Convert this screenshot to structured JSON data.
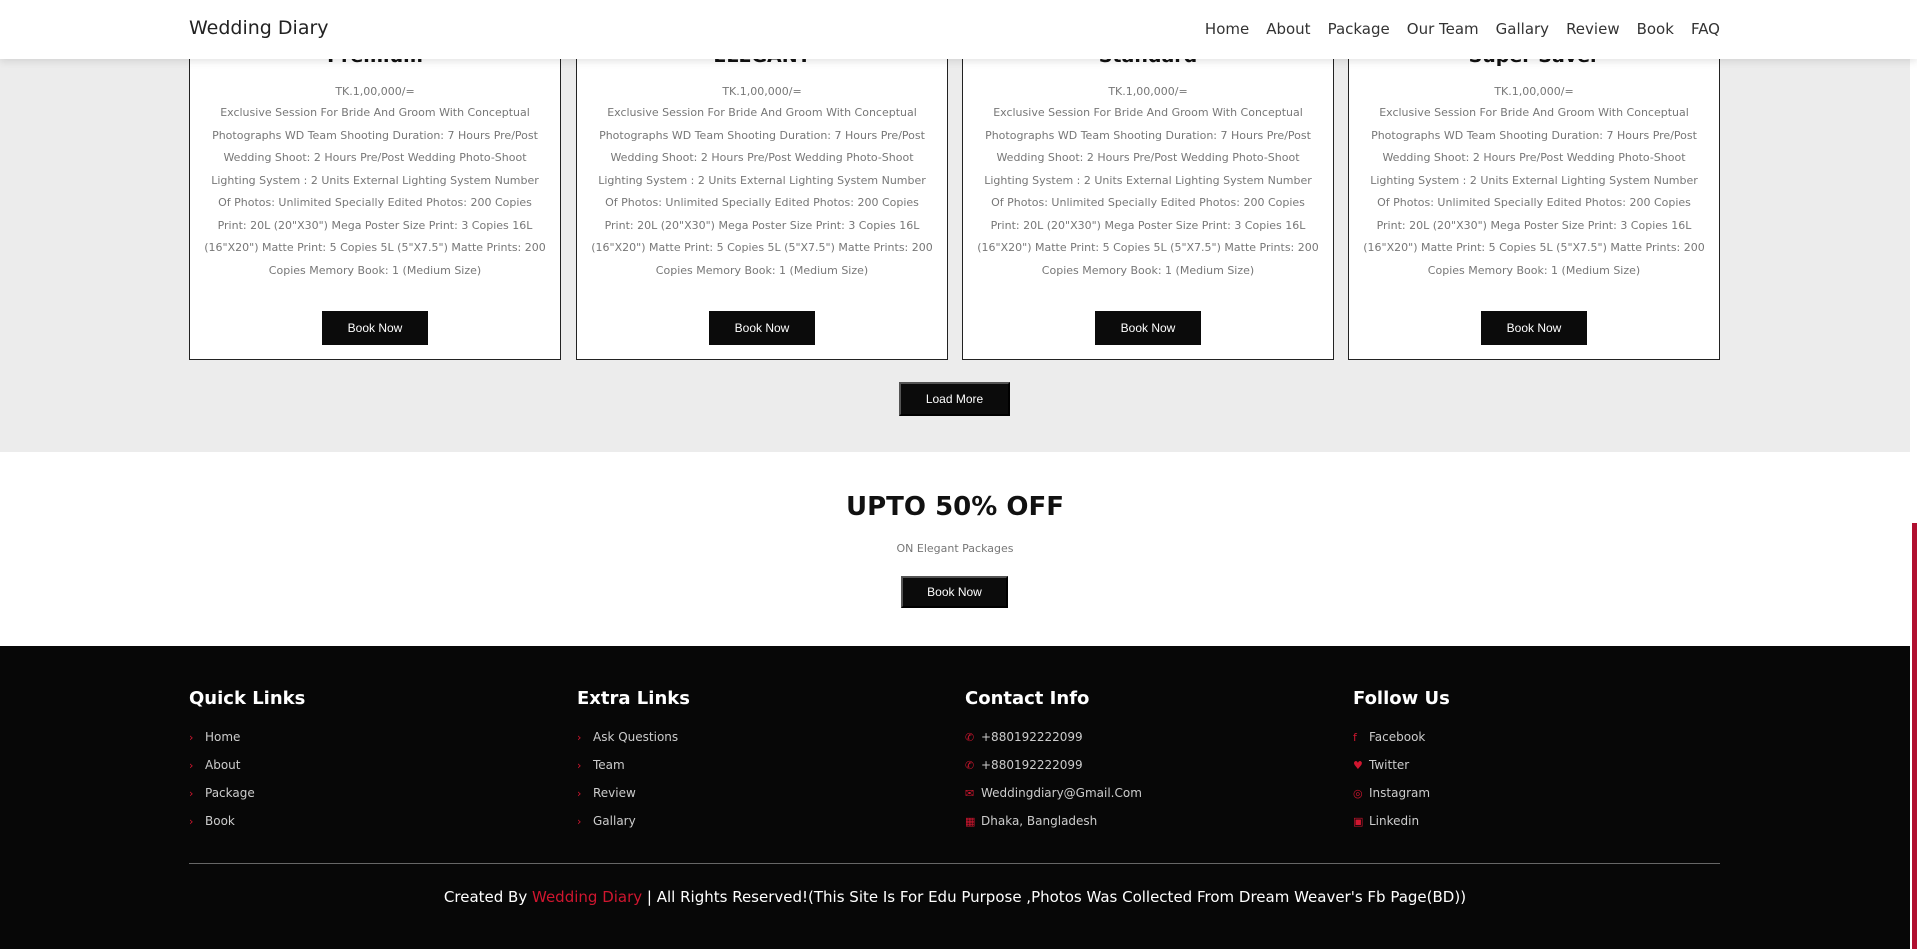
{
  "header": {
    "brand": "Wedding Diary",
    "nav": [
      "Home",
      "About",
      "Package",
      "Our Team",
      "Gallary",
      "Review",
      "Book",
      "FAQ"
    ]
  },
  "packages": [
    {
      "title": "Premium",
      "price": "TK.1,00,000/=",
      "description": "Exclusive Session For Bride And Groom With Conceptual Photographs WD Team Shooting Duration: 7 Hours Pre/Post Wedding Shoot: 2 Hours Pre/Post Wedding Photo-Shoot Lighting System : 2 Units External Lighting System Number Of Photos: Unlimited Specially Edited Photos: 200 Copies Print: 20L (20\"X30\") Mega Poster Size Print: 3 Copies 16L (16\"X20\") Matte Print: 5 Copies 5L (5\"X7.5\") Matte Prints: 200 Copies Memory Book: 1 (Medium Size)",
      "button": "Book Now"
    },
    {
      "title": "ELEGANT",
      "price": "TK.1,00,000/=",
      "description": "Exclusive Session For Bride And Groom With Conceptual Photographs WD Team Shooting Duration: 7 Hours Pre/Post Wedding Shoot: 2 Hours Pre/Post Wedding Photo-Shoot Lighting System : 2 Units External Lighting System Number Of Photos: Unlimited Specially Edited Photos: 200 Copies Print: 20L (20\"X30\") Mega Poster Size Print: 3 Copies 16L (16\"X20\") Matte Print: 5 Copies 5L (5\"X7.5\") Matte Prints: 200 Copies Memory Book: 1 (Medium Size)",
      "button": "Book Now"
    },
    {
      "title": "Standard",
      "price": "TK.1,00,000/=",
      "description": "Exclusive Session For Bride And Groom With Conceptual Photographs WD Team Shooting Duration: 7 Hours Pre/Post Wedding Shoot: 2 Hours Pre/Post Wedding Photo-Shoot Lighting System : 2 Units External Lighting System Number Of Photos: Unlimited Specially Edited Photos: 200 Copies Print: 20L (20\"X30\") Mega Poster Size Print: 3 Copies 16L (16\"X20\") Matte Print: 5 Copies 5L (5\"X7.5\") Matte Prints: 200 Copies Memory Book: 1 (Medium Size)",
      "button": "Book Now"
    },
    {
      "title": "Super Saver",
      "price": "TK.1,00,000/=",
      "description": "Exclusive Session For Bride And Groom With Conceptual Photographs WD Team Shooting Duration: 7 Hours Pre/Post Wedding Shoot: 2 Hours Pre/Post Wedding Photo-Shoot Lighting System : 2 Units External Lighting System Number Of Photos: Unlimited Specially Edited Photos: 200 Copies Print: 20L (20\"X30\") Mega Poster Size Print: 3 Copies 16L (16\"X20\") Matte Print: 5 Copies 5L (5\"X7.5\") Matte Prints: 200 Copies Memory Book: 1 (Medium Size)",
      "button": "Book Now"
    }
  ],
  "load_more": "Load More",
  "offer": {
    "title": "UPTO 50% OFF",
    "subtitle": "ON Elegant Packages",
    "button": "Book Now"
  },
  "footer": {
    "quick_links": {
      "title": "Quick Links",
      "items": [
        "Home",
        "About",
        "Package",
        "Book"
      ]
    },
    "extra_links": {
      "title": "Extra Links",
      "items": [
        "Ask Questions",
        "Team",
        "Review",
        "Gallary"
      ]
    },
    "contact": {
      "title": "Contact Info",
      "items": [
        "+880192222099",
        "+880192222099",
        "Weddingdiary@Gmail.Com",
        "Dhaka, Bangladesh"
      ]
    },
    "follow": {
      "title": "Follow Us",
      "items": [
        "Facebook",
        "Twitter",
        "Instagram",
        "Linkedin"
      ]
    },
    "credit_prefix": "Created By ",
    "credit_brand": "Wedding Diary",
    "credit_suffix": " | All Rights Reserved!(This Site Is For Edu Purpose ,Photos Was Collected From Dream Weaver's Fb Page(BD))"
  },
  "colors": {
    "accent": "#d0162f",
    "dark": "#070707",
    "section_bg": "#ececec"
  }
}
